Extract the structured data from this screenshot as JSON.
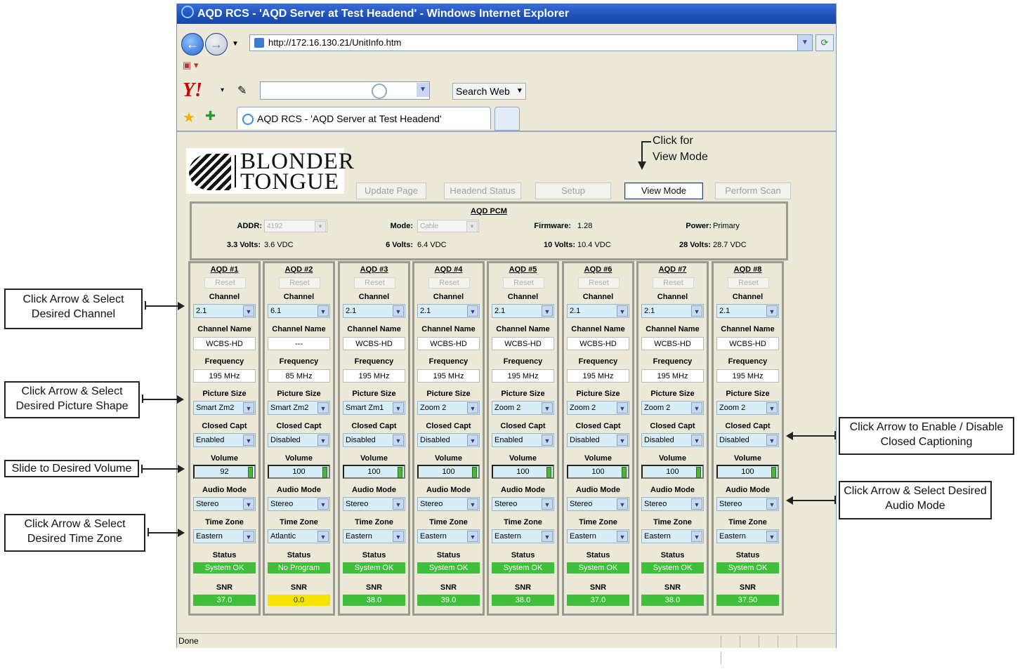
{
  "browser": {
    "title": "AQD RCS - 'AQD Server at Test Headend' - Windows Internet Explorer",
    "url": "http://172.16.130.21/UnitInfo.htm",
    "search_button": "Search Web",
    "tab_title": "AQD RCS - 'AQD Server at Test Headend'",
    "status": "Done"
  },
  "logo": {
    "line1": "BLONDER",
    "line2": "TONGUE"
  },
  "buttons": {
    "update": "Update Page",
    "headend": "Headend Status",
    "setup": "Setup",
    "view": "View Mode",
    "scan": "Perform Scan"
  },
  "pcm": {
    "title": "AQD PCM",
    "addr_label": "ADDR:",
    "addr_value": "4192",
    "mode_label": "Mode:",
    "mode_value": "Cable",
    "firmware_label": "Firmware:",
    "firmware_value": "1.28",
    "power_label": "Power:",
    "power_value": "Primary",
    "v33_label": "3.3 Volts:",
    "v33_value": "3.6 VDC",
    "v6_label": "6 Volts:",
    "v6_value": "6.4 VDC",
    "v10_label": "10 Volts:",
    "v10_value": "10.4 VDC",
    "v28_label": "28 Volts:",
    "v28_value": "28.7 VDC"
  },
  "labels": {
    "reset": "Reset",
    "channel": "Channel",
    "channel_name": "Channel Name",
    "frequency": "Frequency",
    "picture_size": "Picture Size",
    "closed_capt": "Closed Capt",
    "volume": "Volume",
    "audio_mode": "Audio Mode",
    "time_zone": "Time Zone",
    "status": "Status",
    "snr": "SNR"
  },
  "status_colors": {
    "ok": "#3fbf3a",
    "warn": "#f5e400"
  },
  "aqds": [
    {
      "name": "AQD #1",
      "channel": "2.1",
      "channel_name": "WCBS-HD",
      "frequency": "195 MHz",
      "picture_size": "Smart Zm2",
      "closed_capt": "Enabled",
      "volume": "92",
      "audio_mode": "Stereo",
      "time_zone": "Eastern",
      "status": "System OK",
      "snr": "37.0",
      "snr_warn": false
    },
    {
      "name": "AQD #2",
      "channel": "6.1",
      "channel_name": "---",
      "frequency": "85 MHz",
      "picture_size": "Smart Zm2",
      "closed_capt": "Disabled",
      "volume": "100",
      "audio_mode": "Stereo",
      "time_zone": "Atlantic",
      "status": "No Program",
      "snr": "0.0",
      "snr_warn": true
    },
    {
      "name": "AQD #3",
      "channel": "2.1",
      "channel_name": "WCBS-HD",
      "frequency": "195 MHz",
      "picture_size": "Smart Zm1",
      "closed_capt": "Disabled",
      "volume": "100",
      "audio_mode": "Stereo",
      "time_zone": "Eastern",
      "status": "System OK",
      "snr": "38.0",
      "snr_warn": false
    },
    {
      "name": "AQD #4",
      "channel": "2.1",
      "channel_name": "WCBS-HD",
      "frequency": "195 MHz",
      "picture_size": "Zoom 2",
      "closed_capt": "Disabled",
      "volume": "100",
      "audio_mode": "Stereo",
      "time_zone": "Eastern",
      "status": "System OK",
      "snr": "39.0",
      "snr_warn": false
    },
    {
      "name": "AQD #5",
      "channel": "2.1",
      "channel_name": "WCBS-HD",
      "frequency": "195 MHz",
      "picture_size": "Zoom 2",
      "closed_capt": "Enabled",
      "volume": "100",
      "audio_mode": "Stereo",
      "time_zone": "Eastern",
      "status": "System OK",
      "snr": "38.0",
      "snr_warn": false
    },
    {
      "name": "AQD #6",
      "channel": "2.1",
      "channel_name": "WCBS-HD",
      "frequency": "195 MHz",
      "picture_size": "Zoom 2",
      "closed_capt": "Disabled",
      "volume": "100",
      "audio_mode": "Stereo",
      "time_zone": "Eastern",
      "status": "System OK",
      "snr": "37.0",
      "snr_warn": false
    },
    {
      "name": "AQD #7",
      "channel": "2.1",
      "channel_name": "WCBS-HD",
      "frequency": "195 MHz",
      "picture_size": "Zoom 2",
      "closed_capt": "Disabled",
      "volume": "100",
      "audio_mode": "Stereo",
      "time_zone": "Eastern",
      "status": "System OK",
      "snr": "38.0",
      "snr_warn": false
    },
    {
      "name": "AQD #8",
      "channel": "2.1",
      "channel_name": "WCBS-HD",
      "frequency": "195 MHz",
      "picture_size": "Zoom 2",
      "closed_capt": "Disabled",
      "volume": "100",
      "audio_mode": "Stereo",
      "time_zone": "Eastern",
      "status": "System OK",
      "snr": "37.50",
      "snr_warn": false
    }
  ],
  "callouts": {
    "channel": "Click Arrow & Select Desired Channel",
    "picture": "Click Arrow & Select Desired Picture Shape",
    "volume": "Slide to Desired Volume",
    "timezone": "Click Arrow & Select Desired Time Zone",
    "captioning": "Click Arrow to Enable / Disable Closed Captioning",
    "audio": "Click Arrow & Select Desired Audio Mode",
    "viewmode_line1": "Click for",
    "viewmode_line2": "View Mode"
  }
}
